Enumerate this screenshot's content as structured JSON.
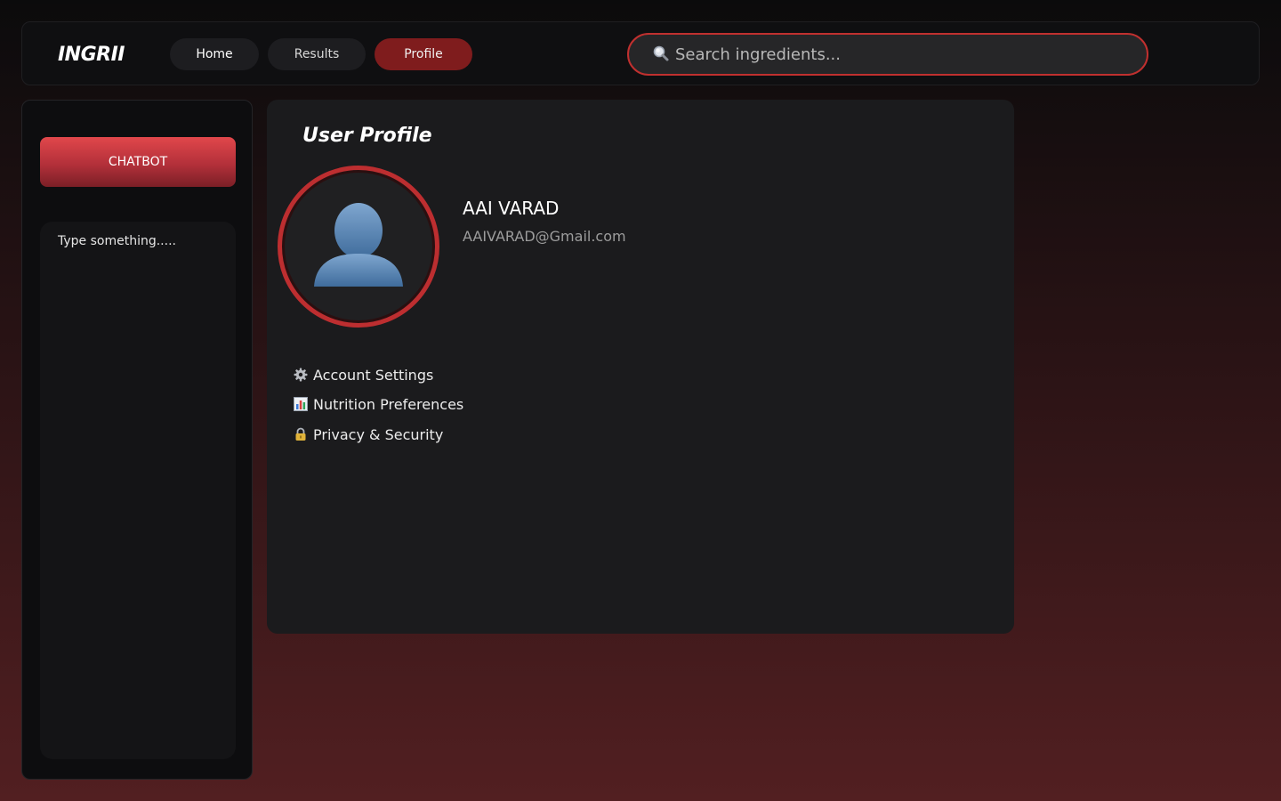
{
  "app": {
    "logo": "INGRII"
  },
  "nav": {
    "items": [
      {
        "label": "Home"
      },
      {
        "label": "Results"
      },
      {
        "label": "Profile"
      }
    ],
    "active": "Profile"
  },
  "search": {
    "placeholder": "Search ingredients...",
    "icon": "magnifier-icon"
  },
  "sidebar": {
    "chatbot_label": "CHATBOT",
    "chat_placeholder": "Type something....."
  },
  "profile": {
    "title": "User Profile",
    "name": "AAI VARAD",
    "email": "AAIVARAD@Gmail.com",
    "avatar_icon": "user-silhouette-icon",
    "menu": [
      {
        "icon": "gear-icon",
        "label": "Account Settings"
      },
      {
        "icon": "bar-chart-icon",
        "label": "Nutrition Preferences"
      },
      {
        "icon": "lock-icon",
        "label": "Privacy & Security"
      }
    ]
  },
  "colors": {
    "accent": "#c0302f",
    "active_nav": "#7f1c1d",
    "card": "#1b1b1d",
    "panel": "#0d0d0f"
  }
}
